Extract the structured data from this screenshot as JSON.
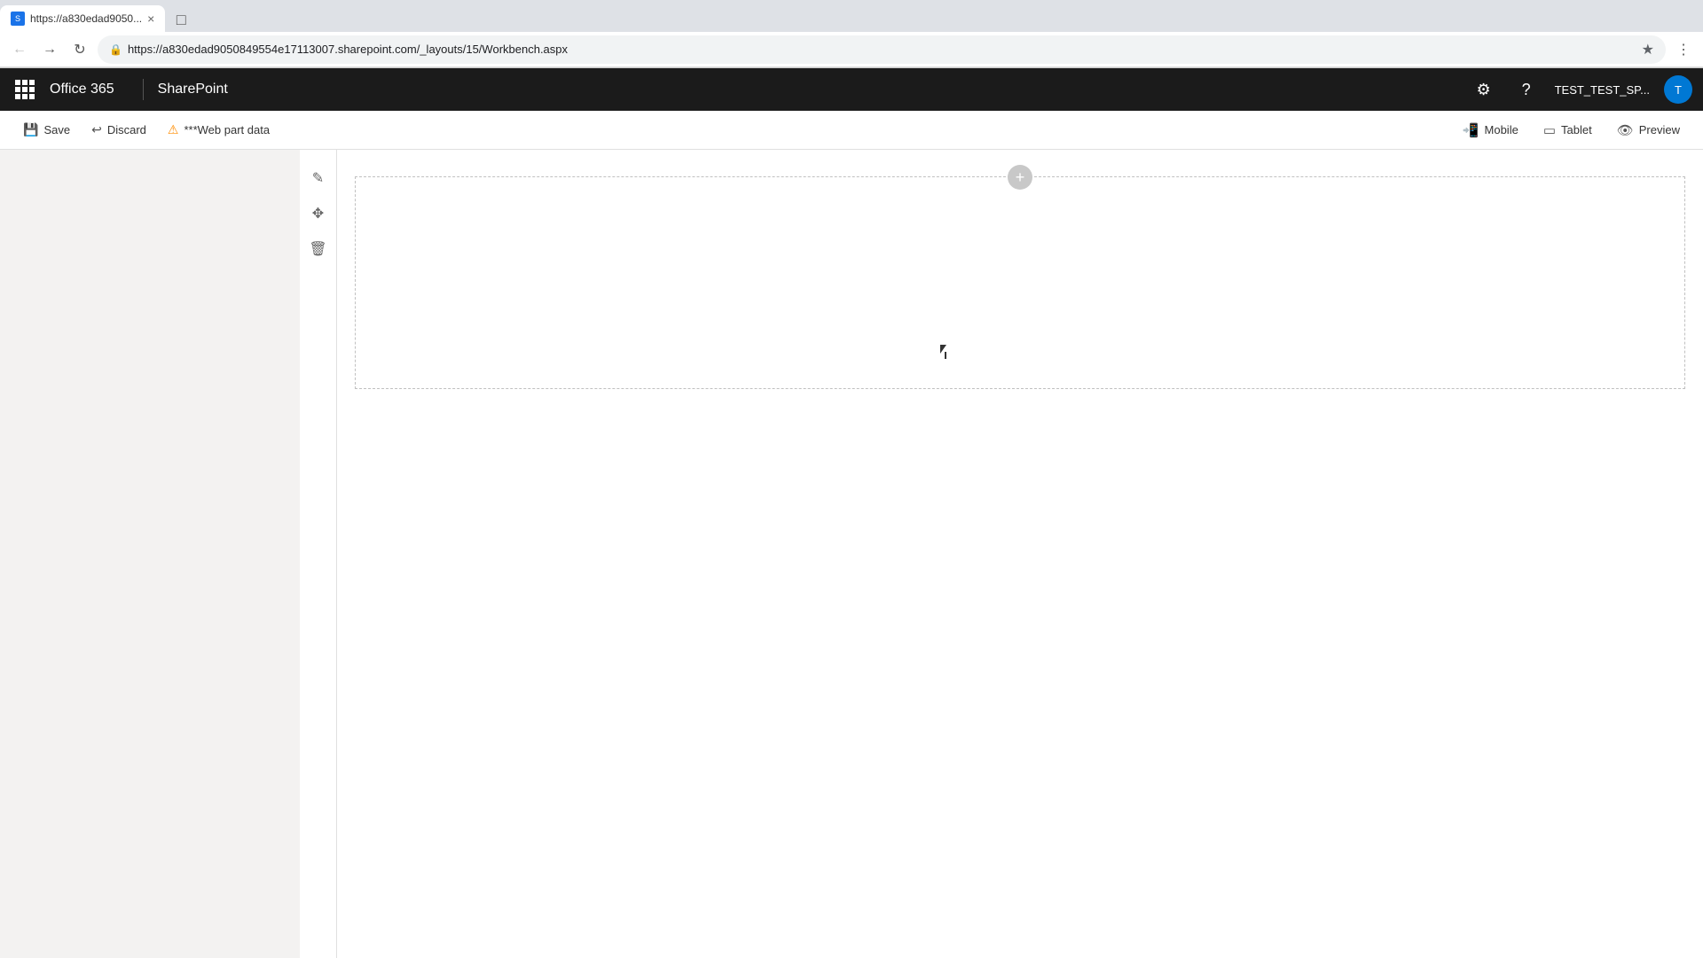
{
  "browser": {
    "tab": {
      "favicon_letter": "S",
      "title": "https://a830edad9050...",
      "close": "×"
    },
    "new_tab_icon": "□",
    "address": {
      "secure_label": "Secure",
      "url": "https://a830edad9050849554e17113007.sharepoint.com/_layouts/15/Workbench.aspx"
    }
  },
  "header": {
    "app_title": "Office 365",
    "app_subtitle": "SharePoint",
    "user_name": "TEST_TEST_SP...",
    "user_avatar_initials": "T",
    "settings_label": "Settings",
    "help_label": "Help"
  },
  "toolbar": {
    "save_label": "Save",
    "discard_label": "Discard",
    "webpart_label": "***Web part data",
    "mobile_label": "Mobile",
    "tablet_label": "Tablet",
    "preview_label": "Preview"
  },
  "canvas": {
    "add_btn_label": "+"
  }
}
